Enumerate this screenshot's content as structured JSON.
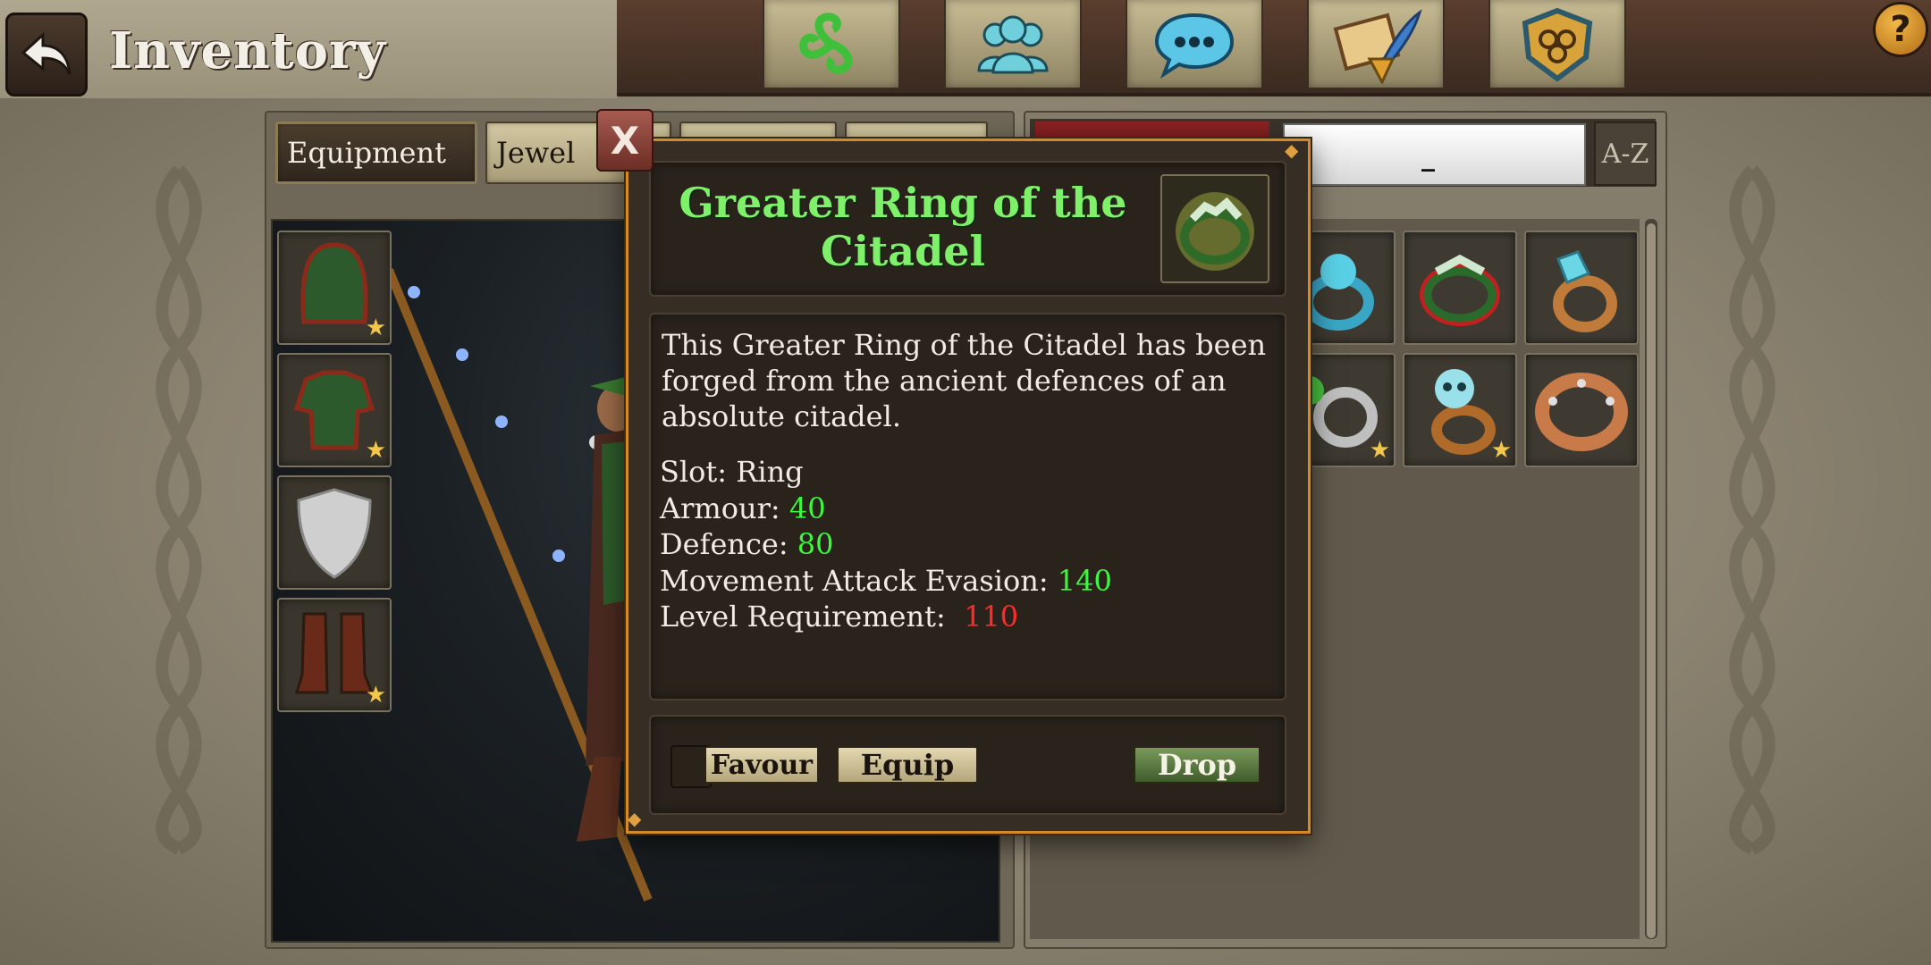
{
  "header": {
    "title": "Inventory",
    "back_icon": "back-arrow-icon",
    "help_label": "?"
  },
  "top_nav": [
    {
      "icon": "triskele-icon"
    },
    {
      "icon": "friends-icon"
    },
    {
      "icon": "chat-icon"
    },
    {
      "icon": "quest-scroll-icon"
    },
    {
      "icon": "guild-shield-icon"
    }
  ],
  "tabs": [
    {
      "label": "Equipment",
      "active": true
    },
    {
      "label": "Jewel"
    },
    {
      "label": ""
    },
    {
      "label": ""
    }
  ],
  "sort": {
    "search_value": "_",
    "az_label": "A-Z"
  },
  "tooltip": {
    "item_name": "Greater Ring of the Citadel",
    "close_label": "X",
    "description": "This Greater Ring of the Citadel has been forged from the ancient defences of an absolute citadel.",
    "stats": [
      {
        "label": "Slot: ",
        "value": "Ring",
        "color": "plain"
      },
      {
        "label": "Armour: ",
        "value": "40",
        "color": "green"
      },
      {
        "label": "Defence: ",
        "value": "80",
        "color": "green"
      },
      {
        "label": "Movement Attack Evasion: ",
        "value": "140",
        "color": "green"
      },
      {
        "label": "Level Requirement:  ",
        "value": "110",
        "color": "red"
      }
    ],
    "buttons": {
      "favour": "Favour",
      "equip": "Equip",
      "drop": "Drop"
    }
  },
  "colors": {
    "item_name": "#7ff06a",
    "stat_green": "#3df63d",
    "stat_red": "#ff2a2a",
    "popup_border": "#d58a2a"
  }
}
